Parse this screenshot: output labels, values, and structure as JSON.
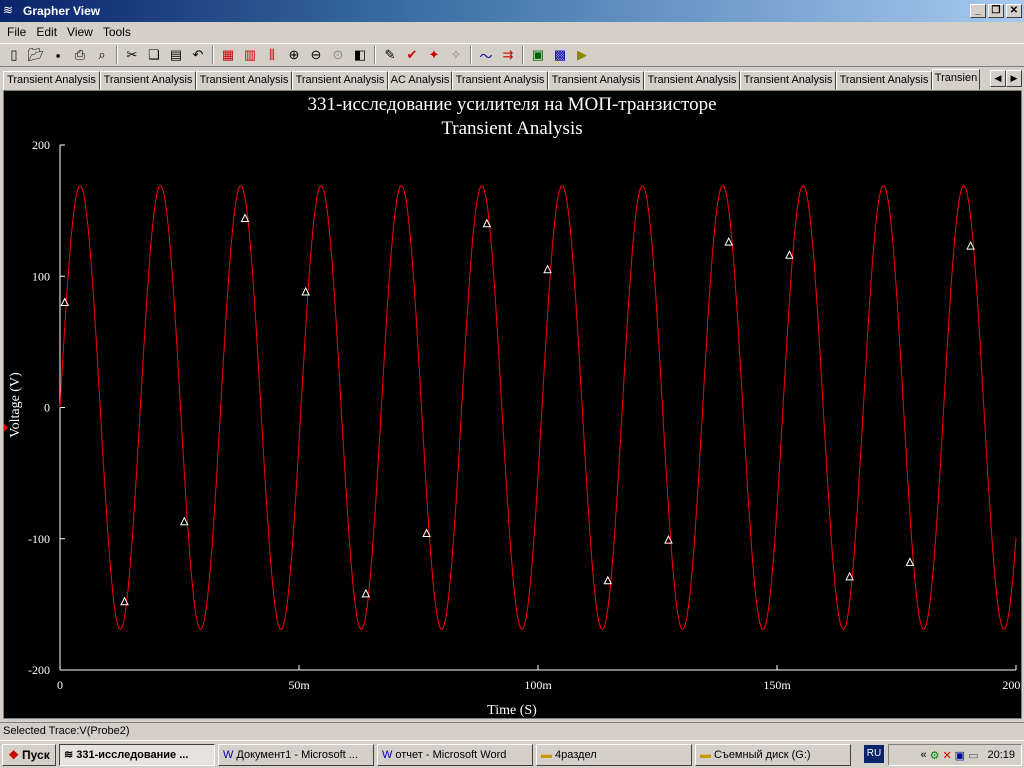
{
  "window": {
    "title": "Grapher View"
  },
  "menu": [
    "File",
    "Edit",
    "View",
    "Tools"
  ],
  "tabs": [
    "Transient Analysis",
    "Transient Analysis",
    "Transient Analysis",
    "Transient Analysis",
    "AC Analysis",
    "Transient Analysis",
    "Transient Analysis",
    "Transient Analysis",
    "Transient Analysis",
    "Transient Analysis",
    "Transien"
  ],
  "status": "Selected Trace:V(Probe2)",
  "taskbar": {
    "start": "Пуск",
    "tasks": [
      "331-исследование ...",
      "Документ1 - Microsoft ...",
      "отчет - Microsoft Word",
      "4раздел",
      "Съемный диск (G:)"
    ],
    "lang": "RU",
    "tray_arrow": "«",
    "clock": "20:19"
  },
  "colors": {
    "trace": "#ff0000",
    "plot_bg": "#000000",
    "axis": "#ffffff",
    "titlebar": "#0a246a"
  },
  "chart_data": {
    "type": "line",
    "title": "331-исследование усилителя на МОП-транзисторе",
    "subtitle": "Transient Analysis",
    "xlabel": "Time (S)",
    "ylabel": "Voltage (V)",
    "xlim": [
      0,
      0.2
    ],
    "ylim": [
      -200,
      200
    ],
    "xticks": [
      0,
      0.05,
      0.1,
      0.15,
      0.2
    ],
    "xtick_labels": [
      "0",
      "50m",
      "100m",
      "150m",
      "200m"
    ],
    "yticks": [
      200,
      100,
      0,
      -100,
      -200
    ],
    "ytick_labels": [
      "200",
      "100",
      "0",
      "-100",
      "-200"
    ],
    "grid": false,
    "series": [
      {
        "trace": "V(Probe2)",
        "color": "#ff0000",
        "waveform": "sine",
        "amplitude": 169,
        "frequency_hz": 59.5,
        "phase_deg": 0,
        "markers": [
          [
            0.001,
            80
          ],
          [
            0.0135,
            -148
          ],
          [
            0.026,
            -87
          ],
          [
            0.0387,
            144
          ],
          [
            0.0514,
            88
          ],
          [
            0.064,
            -142
          ],
          [
            0.0767,
            -96
          ],
          [
            0.0893,
            140
          ],
          [
            0.102,
            105
          ],
          [
            0.1146,
            -132
          ],
          [
            0.1273,
            -101
          ],
          [
            0.1399,
            126
          ],
          [
            0.1526,
            116
          ],
          [
            0.1652,
            -129
          ],
          [
            0.1778,
            -118
          ],
          [
            0.1905,
            123
          ]
        ]
      }
    ]
  }
}
